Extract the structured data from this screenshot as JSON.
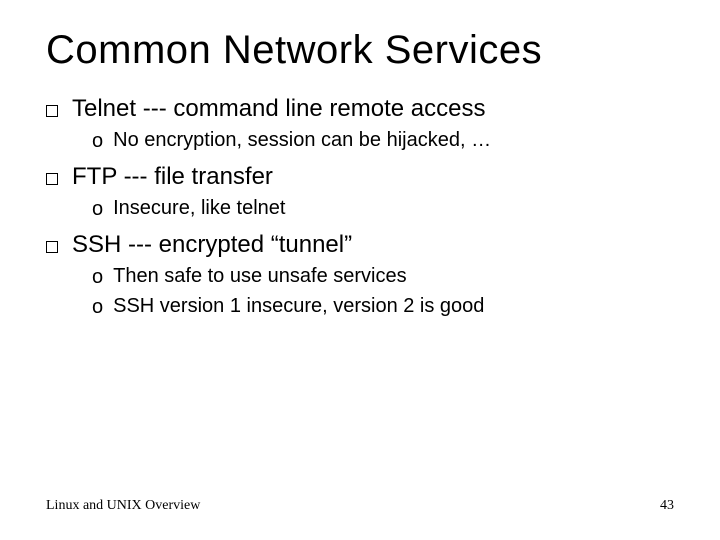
{
  "title": "Common Network Services",
  "items": [
    {
      "text": "Telnet --- command line remote access",
      "subs": [
        "No encryption, session can be hijacked, …"
      ]
    },
    {
      "text": "FTP --- file transfer",
      "subs": [
        "Insecure, like telnet"
      ]
    },
    {
      "text": "SSH --- encrypted “tunnel”",
      "subs": [
        "Then safe to use unsafe services",
        "SSH version 1 insecure, version 2 is good"
      ]
    }
  ],
  "footer_left": "Linux and UNIX Overview",
  "footer_right": "43",
  "sub_bullet_glyph": "o"
}
